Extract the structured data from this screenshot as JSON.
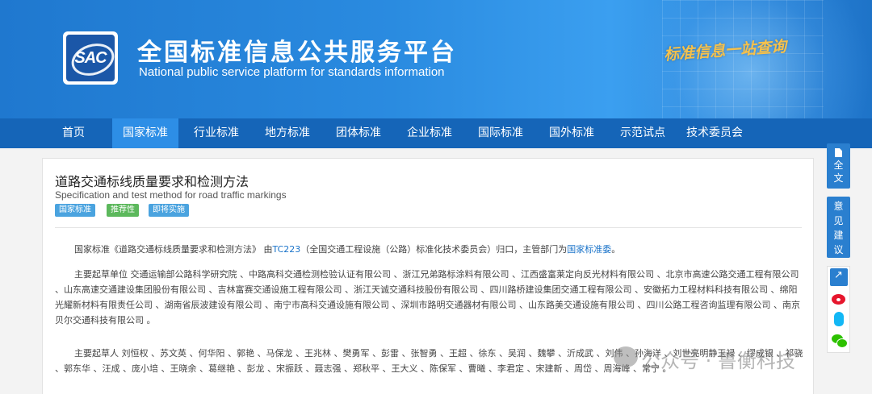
{
  "header": {
    "logo_text": "SAC",
    "title": "全国标准信息公共服务平台",
    "subtitle": "National public service platform  for standards information",
    "slogan": "标准信息一站查询"
  },
  "nav": [
    "首页",
    "国家标准",
    "行业标准",
    "地方标准",
    "团体标准",
    "企业标准",
    "国际标准",
    "国外标准",
    "示范试点",
    "技术委员会"
  ],
  "nav_active": "国家标准",
  "standard": {
    "title": "道路交通标线质量要求和检测方法",
    "english_title": "Specification and test method for road traffic markings",
    "badges": [
      "国家标准",
      "推荐性",
      "即将实施"
    ],
    "summary": {
      "prefix": "国家标准《道路交通标线质量要求和检测方法》 由",
      "committee_code": "TC223",
      "middle": "（全国交通工程设施（公路）标准化技术委员会）归口，主管部门为",
      "authority": "国家标准委",
      "suffix": "。"
    },
    "drafting_units": "主要起草单位 交通运输部公路科学研究院 、中路高科交通检测检验认证有限公司 、浙江兄弟路标涂料有限公司 、江西盛富莱定向反光材料有限公司 、北京市高速公路交通工程有限公司 、山东高速交通建设集团股份有限公司 、吉林富赛交通设施工程有限公司 、浙江天诚交通科技股份有限公司 、四川路桥建设集团交通工程有限公司 、安徽拓力工程材料科技有限公司 、绵阳光耀新材料有限责任公司 、湖南省辰波建设有限公司 、南宁市高科交通设施有限公司 、深圳市路明交通器材有限公司 、山东路美交通设施有限公司 、四川公路工程咨询监理有限公司 、南京贝尔交通科技有限公司 。",
    "drafters": "主要起草人 刘恒权 、苏文英 、何华阳 、郭艳 、马保龙 、王兆林 、樊勇军 、彭雷 、张智勇 、王超 、徐东 、吴润 、魏攀 、沂成武 、刘伟 、孙海洋 、刘世亮明静玉禄 、缪成银 、祁骁 、郭东华 、汪成 、庞小培 、王晓余 、葛继艳 、彭龙 、宋振跃 、聂志强 、郑秋平 、王大义 、陈保军 、曹曦 、李君定 、宋建新 、周岱 、周海峰 、常宁 。"
  },
  "sidebar": {
    "fulltext_label": "全文",
    "feedback_label": "意见建议"
  },
  "watermark": "公众号 · 鲁衡科技"
}
